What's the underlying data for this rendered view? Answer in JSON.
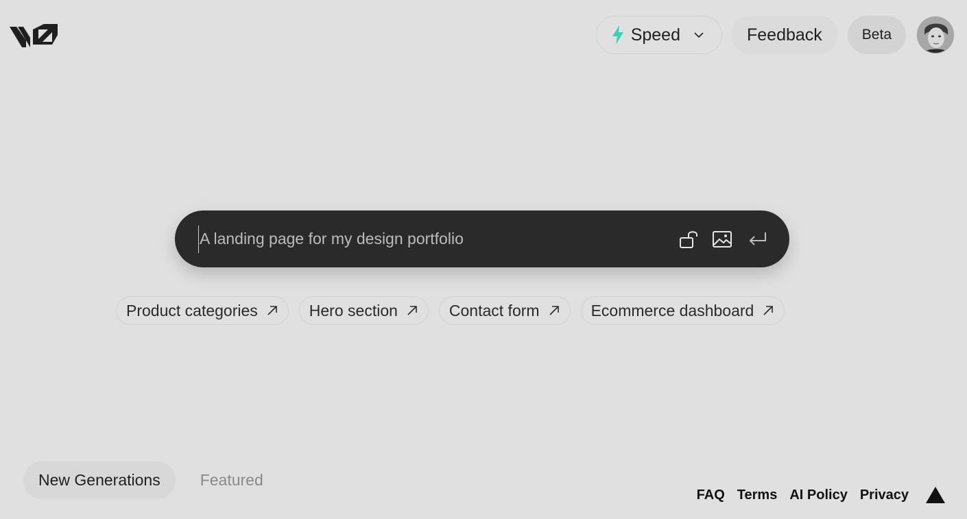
{
  "header": {
    "logo_icon": "v0-logo-icon",
    "model_select": {
      "label": "Speed",
      "icon": "bolt-icon",
      "accent": "#2fd6b8"
    },
    "feedback_label": "Feedback",
    "beta_label": "Beta",
    "avatar_icon": "user-avatar"
  },
  "prompt": {
    "placeholder": "A landing page for my design portfolio",
    "icons": [
      "lock-open-icon",
      "image-icon",
      "enter-icon"
    ]
  },
  "suggestions": [
    {
      "label": "Product categories"
    },
    {
      "label": "Hero section"
    },
    {
      "label": "Contact form"
    },
    {
      "label": "Ecommerce dashboard"
    }
  ],
  "tabs": [
    {
      "label": "New Generations"
    },
    {
      "label": "Featured"
    }
  ],
  "footer": {
    "links": [
      "FAQ",
      "Terms",
      "AI Policy",
      "Privacy"
    ],
    "logo_icon": "vercel-triangle-icon"
  }
}
